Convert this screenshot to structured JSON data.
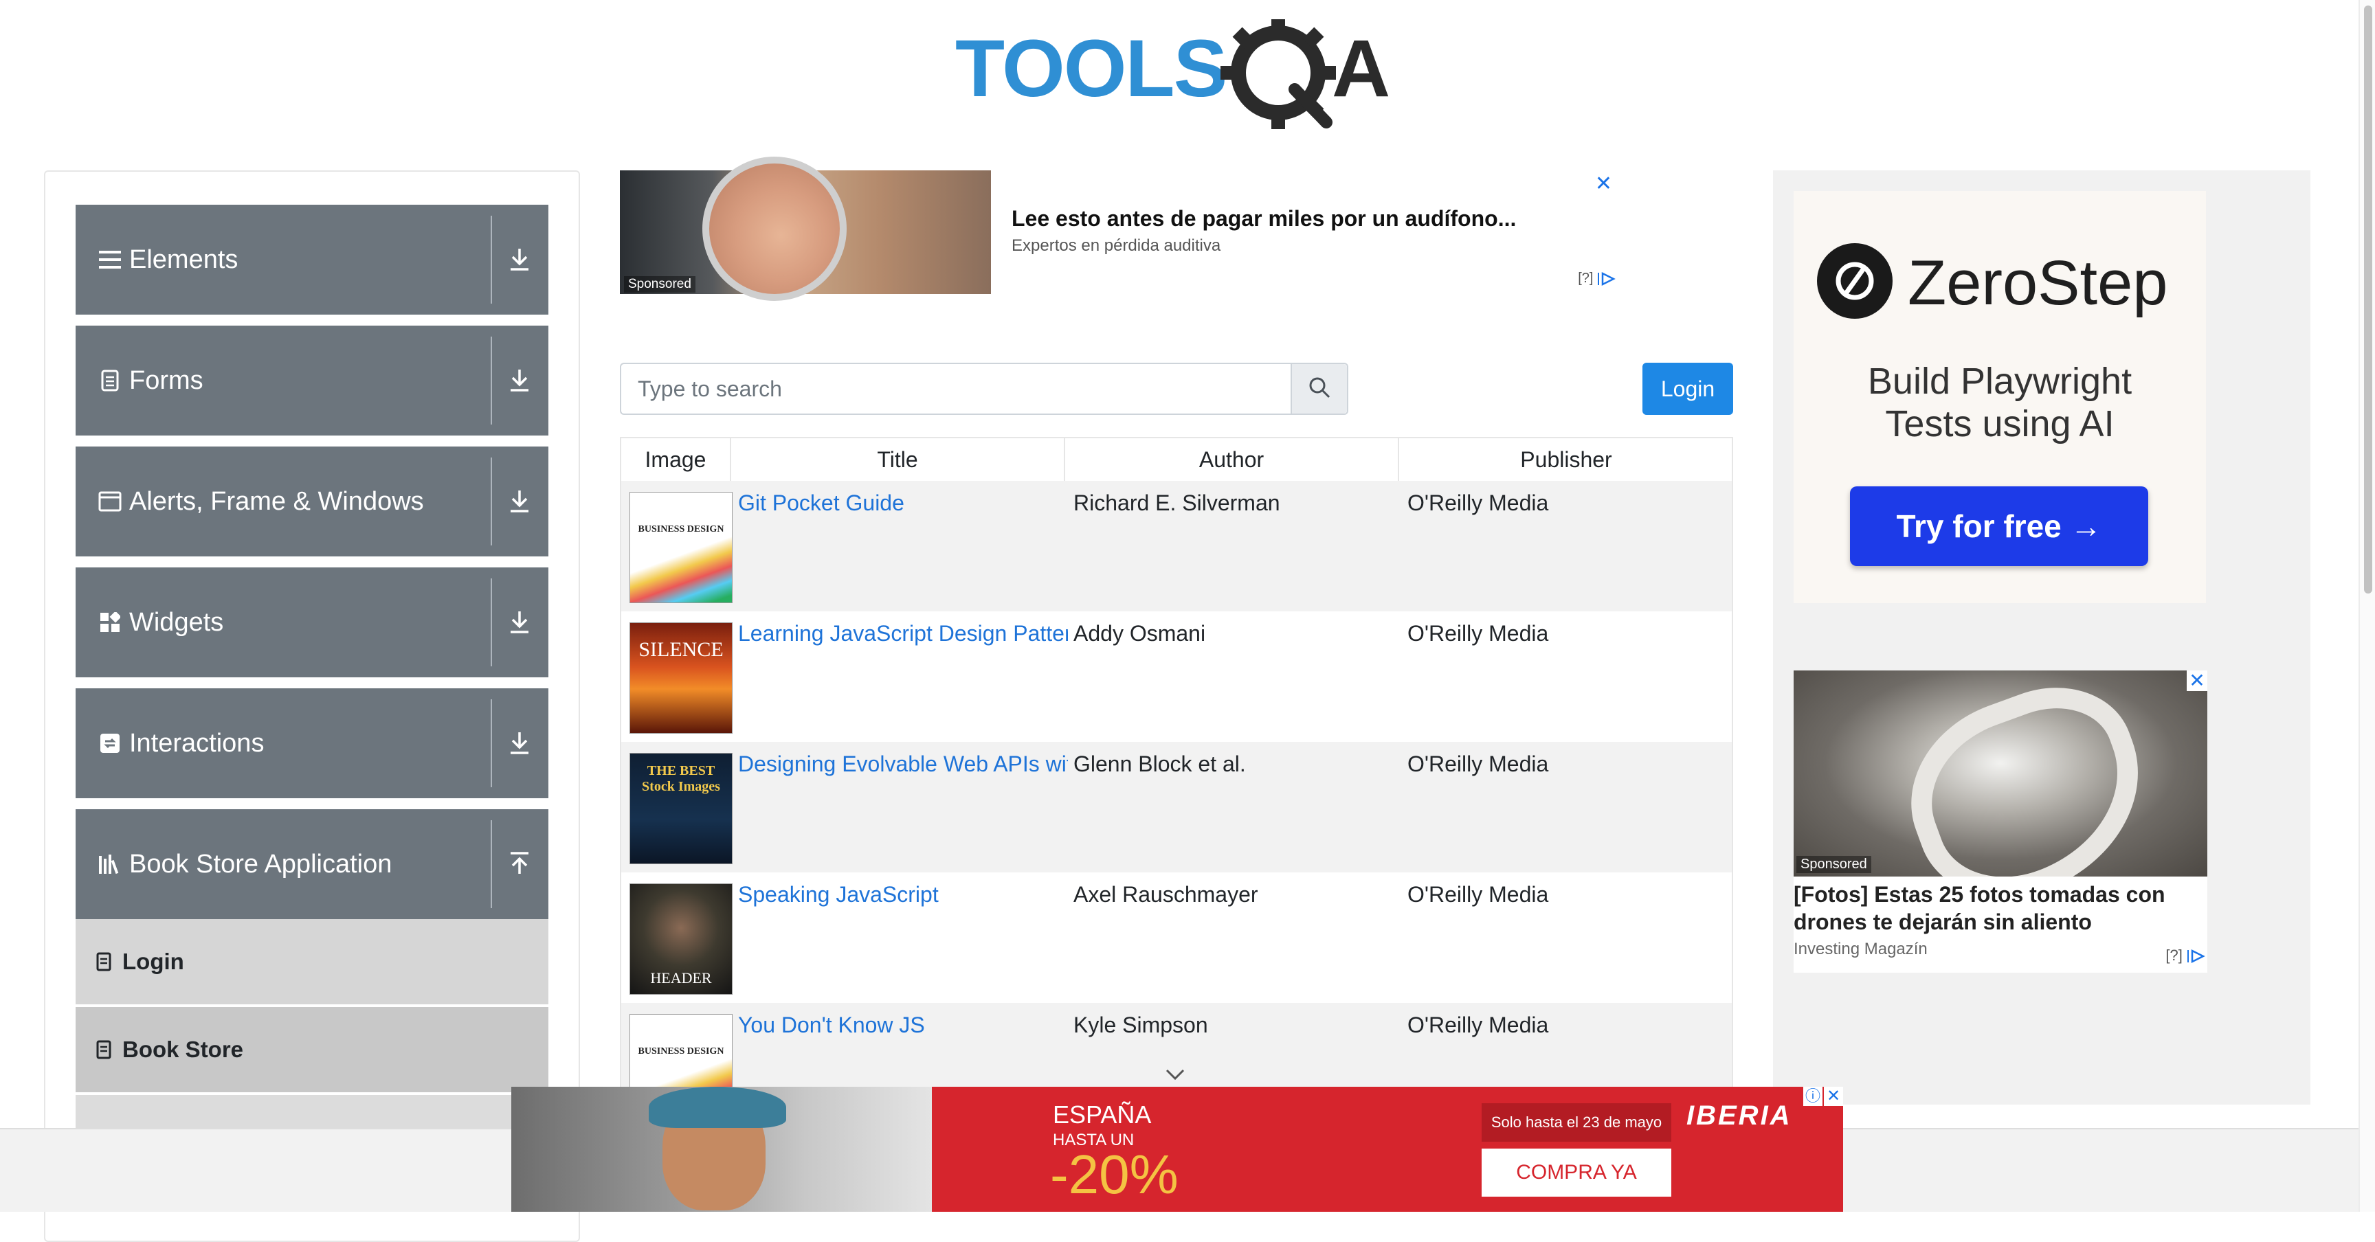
{
  "header": {
    "logo_text_tools": "TOOLS",
    "logo_text_qa": "QA"
  },
  "sidebar": {
    "groups": [
      {
        "label": "Elements",
        "icon": "hamburger-icon"
      },
      {
        "label": "Forms",
        "icon": "form-icon"
      },
      {
        "label": "Alerts, Frame & Windows",
        "icon": "window-icon"
      },
      {
        "label": "Widgets",
        "icon": "widgets-icon"
      },
      {
        "label": "Interactions",
        "icon": "interactions-icon"
      },
      {
        "label": "Book Store Application",
        "icon": "book-store-icon"
      }
    ],
    "subitems": [
      {
        "label": "Login"
      },
      {
        "label": "Book Store"
      }
    ]
  },
  "top_ad": {
    "headline": "Lee esto antes de pagar miles por un audífono...",
    "source": "Expertos en pérdida auditiva",
    "sponsored": "Sponsored",
    "adchoices": "[?]",
    "close": "✕"
  },
  "search": {
    "placeholder": "Type to search"
  },
  "login_button": "Login",
  "table": {
    "columns": [
      "Image",
      "Title",
      "Author",
      "Publisher"
    ],
    "rows": [
      {
        "title": "Git Pocket Guide",
        "author": "Richard E. Silverman",
        "publisher": "O'Reilly Media",
        "cover_text": "BUSINESS DESIGN"
      },
      {
        "title": "Learning JavaScript Design Patterns",
        "author": "Addy Osmani",
        "publisher": "O'Reilly Media",
        "cover_text": "SILENCE"
      },
      {
        "title": "Designing Evolvable Web APIs with ASP.NET",
        "author": "Glenn Block et al.",
        "publisher": "O'Reilly Media",
        "cover_text": "THE BEST Stock Images"
      },
      {
        "title": "Speaking JavaScript",
        "author": "Axel Rauschmayer",
        "publisher": "O'Reilly Media",
        "cover_text": "HEADER"
      },
      {
        "title": "You Don't Know JS",
        "author": "Kyle Simpson",
        "publisher": "O'Reilly Media",
        "cover_text": "BUSINESS DESIGN"
      }
    ]
  },
  "right_ad": {
    "brand": "ZeroStep",
    "subtitle_line1": "Build Playwright",
    "subtitle_line2": "Tests using AI",
    "cta": "Try for free →"
  },
  "right_ad2": {
    "sponsored": "Sponsored",
    "headline": "[Fotos] Estas 25 fotos tomadas con drones te dejarán sin aliento",
    "source": "Investing Magazín",
    "adchoices": "[?]",
    "close": "✕"
  },
  "bottom_ad": {
    "country": "ESPAÑA",
    "upto": "HASTA UN",
    "discount": "-20%",
    "until": "Solo hasta el 23 de mayo",
    "cta": "COMPRA YA",
    "brand": "IBERIA",
    "info": "ⓘ",
    "close": "✕"
  },
  "colors": {
    "sidebar_group_bg": "#6c757d",
    "link": "#1e73d8",
    "primary_button": "#1e88e5",
    "zerostep_cta": "#1d3be8",
    "iberia_red": "#d6252d"
  }
}
